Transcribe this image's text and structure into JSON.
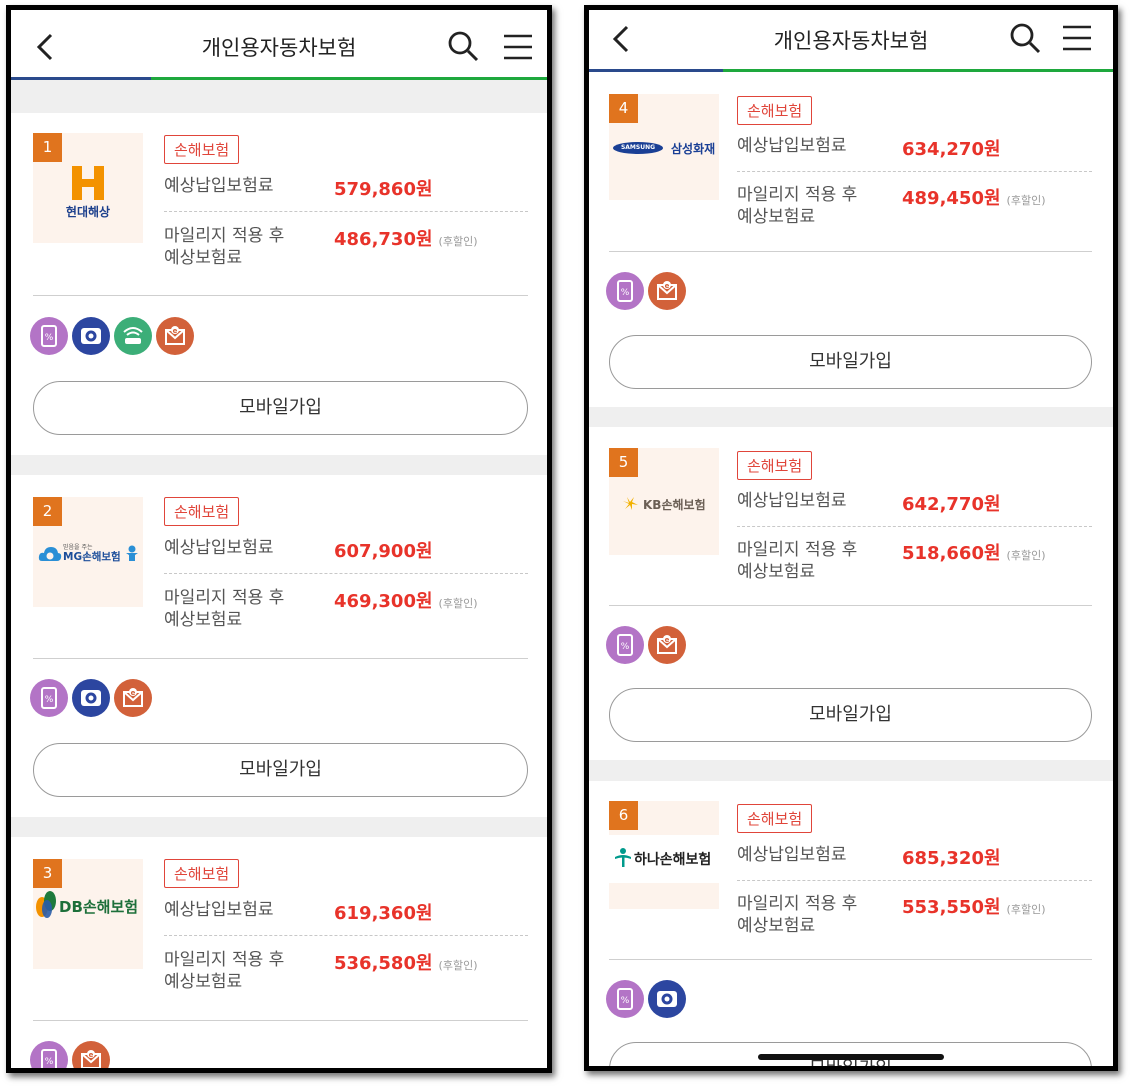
{
  "header": {
    "title": "개인용자동차보험"
  },
  "colors": {
    "accent_red": "#e8332a",
    "rank_orange": "#e0741e",
    "nav_green": "#1ea83d",
    "nav_blue": "#2a4a8c"
  },
  "labels": {
    "badge": "손해보험",
    "premium": "예상납입보험료",
    "mileage_line1": "마일리지 적용 후",
    "mileage_line2": "예상보험료",
    "after_discount": "(후할인)",
    "join_button": "모바일가입"
  },
  "insurers": [
    {
      "rank": "1",
      "name": "현대해상",
      "premium": "579,860원",
      "mileage_premium": "486,730원",
      "features": [
        "mobile-discount-icon",
        "blackbox-icon",
        "connected-car-icon",
        "e-document-icon"
      ]
    },
    {
      "rank": "2",
      "name": "MG손해보험",
      "tagline": "믿음을 주는",
      "premium": "607,900원",
      "mileage_premium": "469,300원",
      "features": [
        "mobile-discount-icon",
        "blackbox-icon",
        "e-document-icon"
      ]
    },
    {
      "rank": "3",
      "name": "DB손해보험",
      "premium": "619,360원",
      "mileage_premium": "536,580원",
      "features": [
        "mobile-discount-icon",
        "e-document-icon"
      ]
    },
    {
      "rank": "4",
      "name": "삼성화재",
      "brand": "SAMSUNG",
      "premium": "634,270원",
      "mileage_premium": "489,450원",
      "features": [
        "mobile-discount-icon",
        "e-document-icon"
      ]
    },
    {
      "rank": "5",
      "name": "KB손해보험",
      "premium": "642,770원",
      "mileage_premium": "518,660원",
      "features": [
        "mobile-discount-icon",
        "e-document-icon"
      ]
    },
    {
      "rank": "6",
      "name": "하나손해보험",
      "premium": "685,320원",
      "mileage_premium": "553,550원",
      "features": [
        "mobile-discount-icon",
        "blackbox-icon"
      ]
    }
  ]
}
